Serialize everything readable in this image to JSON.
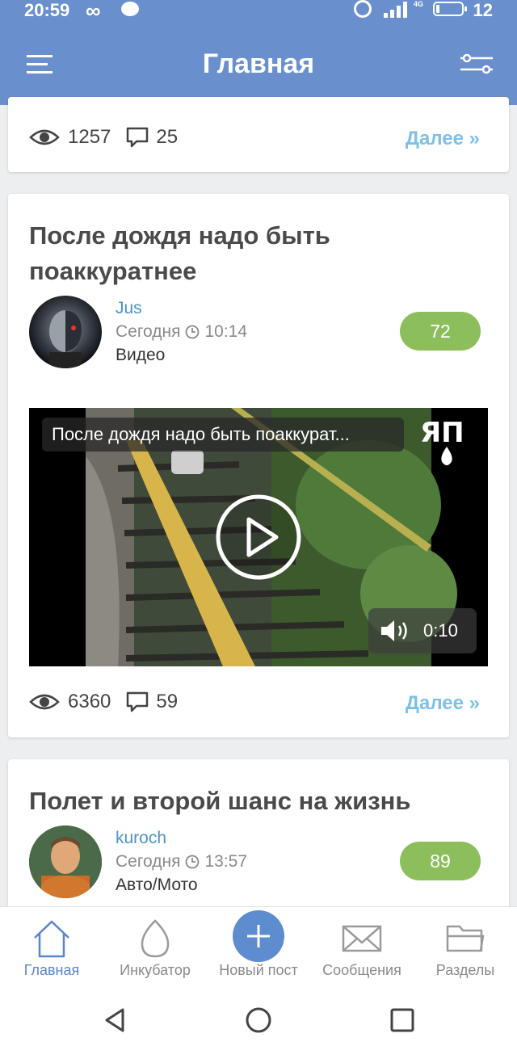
{
  "status_bar": {
    "time": "20:59",
    "infinity": "∞",
    "battery": "12",
    "network": "4G"
  },
  "header": {
    "title": "Главная"
  },
  "card_prev": {
    "views": "1257",
    "comments": "25",
    "more": "Далее »"
  },
  "post1": {
    "title": "После дождя надо быть поаккуратнее",
    "author": "Jus",
    "date": "Сегодня",
    "time": "10:14",
    "category": "Видео",
    "rating": "72",
    "video_title": "После дождя надо быть поаккурат...",
    "video_duration": "0:10",
    "views": "6360",
    "comments": "59",
    "more": "Далее »"
  },
  "post2": {
    "title": "Полет и второй шанс на жизнь",
    "author": "kuroch",
    "date": "Сегодня",
    "time": "13:57",
    "category": "Авто/Мото",
    "rating": "89"
  },
  "bottom_nav": {
    "home": "Главная",
    "incubator": "Инкубатор",
    "new_post": "Новый пост",
    "messages": "Сообщения",
    "sections": "Разделы"
  },
  "colors": {
    "header": "#6a8fcd",
    "rating": "#8cbf5b",
    "link": "#7ec0e8",
    "accent": "#5a86c7"
  }
}
